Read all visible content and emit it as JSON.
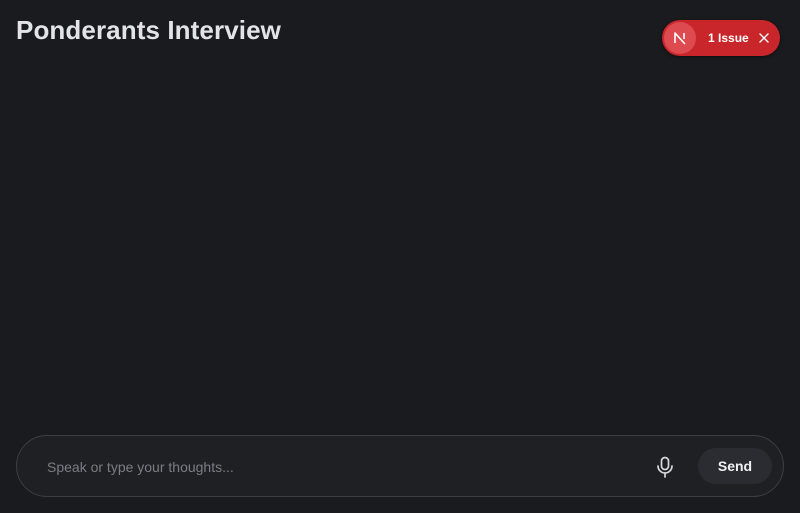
{
  "header": {
    "title": "Ponderants Interview"
  },
  "issue_badge": {
    "avatar_letter": "N",
    "label": "1 Issue",
    "color": "#c9262b",
    "close_icon": "close-icon"
  },
  "composer": {
    "placeholder": "Speak or type your thoughts...",
    "value": "",
    "mic_icon": "microphone-icon",
    "send_label": "Send"
  }
}
